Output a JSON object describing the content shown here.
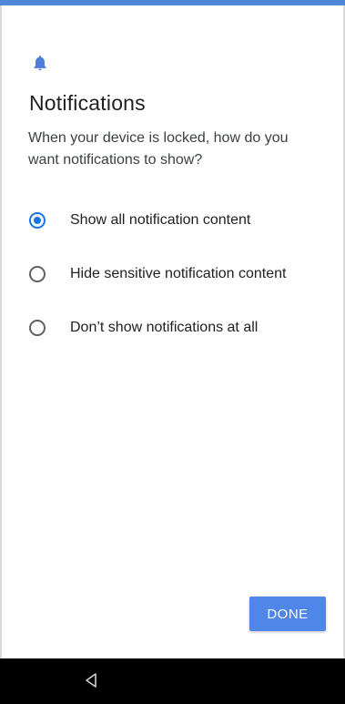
{
  "header": {
    "title": "Notifications",
    "subtitle": "When your device is locked, how do you want notifications to show?",
    "icon": "bell-icon"
  },
  "options": [
    {
      "label": "Show all notification content",
      "selected": true
    },
    {
      "label": "Hide sensitive notification content",
      "selected": false
    },
    {
      "label": "Don’t show notifications at all",
      "selected": false
    }
  ],
  "actions": {
    "done_label": "DONE"
  },
  "colors": {
    "accent": "#1a73e8",
    "button": "#4f86e8",
    "top_bar": "#4f86d6",
    "nav_bar": "#000000"
  },
  "nav": {
    "back_icon": "back-triangle-icon"
  }
}
